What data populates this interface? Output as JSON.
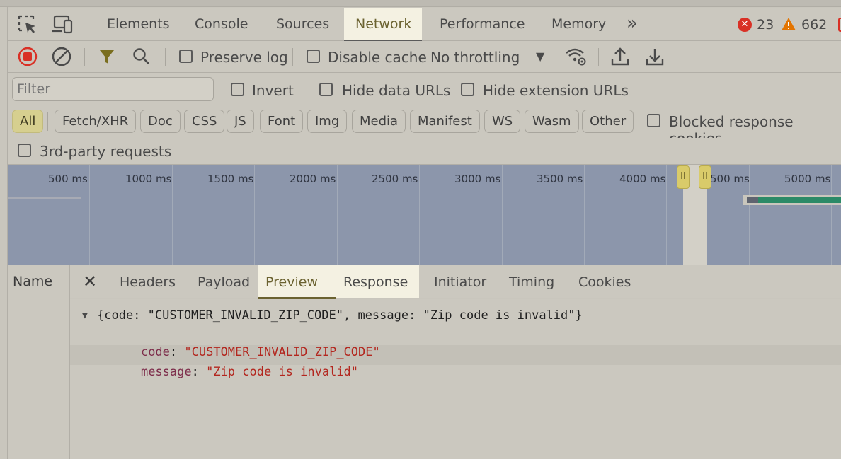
{
  "tabs": {
    "items": [
      "Elements",
      "Console",
      "Sources",
      "Network",
      "Performance",
      "Memory"
    ],
    "more": "»",
    "active": "Network",
    "error_count": "23",
    "warning_count": "662"
  },
  "toolbar": {
    "preserve_log": "Preserve log",
    "disable_cache": "Disable cache",
    "throttling": "No throttling",
    "throttling_arrow": "▼"
  },
  "filter": {
    "placeholder": "Filter",
    "invert": "Invert",
    "hide_data_urls": "Hide data URLs",
    "hide_extension_urls": "Hide extension URLs"
  },
  "types": {
    "items": [
      "All",
      "Fetch/XHR",
      "Doc",
      "CSS",
      "JS",
      "Font",
      "Img",
      "Media",
      "Manifest",
      "WS",
      "Wasm",
      "Other"
    ],
    "active": "All",
    "blocked_cookies": "Blocked response cookies",
    "third_party": "3rd-party requests"
  },
  "timeline": {
    "labels": [
      "500 ms",
      "1000 ms",
      "1500 ms",
      "2000 ms",
      "2500 ms",
      "3000 ms",
      "3500 ms",
      "4000 ms",
      "500 ms",
      "5000 ms"
    ],
    "handle_glyph": "II"
  },
  "detail": {
    "name_header": "Name",
    "close_glyph": "✕",
    "tabs": [
      "Headers",
      "Payload",
      "Preview",
      "Response",
      "Initiator",
      "Timing",
      "Cookies"
    ],
    "active_tab": "Preview"
  },
  "preview": {
    "summary": "{code: \"CUSTOMER_INVALID_ZIP_CODE\", message: \"Zip code is invalid\"}",
    "toggle": "▼",
    "fields": [
      {
        "key": "code",
        "value": "\"CUSTOMER_INVALID_ZIP_CODE\""
      },
      {
        "key": "message",
        "value": "\"Zip code is invalid\""
      }
    ]
  },
  "colors": {
    "error": "#d93025",
    "warning": "#e37400",
    "record": "#d93025",
    "accent": "#6b6230"
  }
}
